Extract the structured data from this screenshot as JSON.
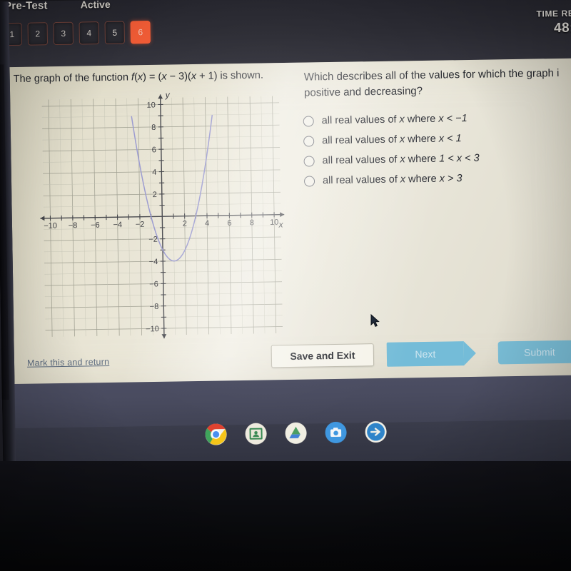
{
  "header": {
    "brand_title": "Pre-Test",
    "status": "Active",
    "question_numbers": [
      "1",
      "2",
      "3",
      "4",
      "5",
      "6"
    ],
    "active_question": "6",
    "timer_label": "TIME RE",
    "timer_value": "48:",
    "active_color": "#ef5a34"
  },
  "question": {
    "stimulus_prefix": "The graph of the function ",
    "stimulus_fn": "f",
    "stimulus_mid": "(",
    "stimulus_x1": "x",
    "stimulus_eq": ") = (",
    "stimulus_x2": "x",
    "stimulus_minus": " − 3)(",
    "stimulus_x3": "x",
    "stimulus_plus": " + 1) is shown.",
    "prompt_line1": "Which describes all of the values for which the graph i",
    "prompt_line2": "positive and decreasing?",
    "choices": [
      {
        "pre": "all real values of ",
        "var": "x",
        "mid": " where ",
        "cond": "x < −1"
      },
      {
        "pre": "all real values of ",
        "var": "x",
        "mid": " where ",
        "cond": "x < 1"
      },
      {
        "pre": "all real values of ",
        "var": "x",
        "mid": " where ",
        "cond": "1 < x < 3"
      },
      {
        "pre": "all real values of ",
        "var": "x",
        "mid": " where ",
        "cond": "x > 3"
      }
    ],
    "selected_choice": null
  },
  "chart_data": {
    "type": "line",
    "title": "",
    "xlabel": "x",
    "ylabel": "y",
    "xlim": [
      -11,
      11
    ],
    "ylim": [
      -11,
      11
    ],
    "grid": true,
    "x_tick_labels": [
      "−10",
      "−8",
      "−6",
      "−4",
      "−2",
      "2",
      "4",
      "6",
      "8",
      "10"
    ],
    "x_tick_values": [
      -10,
      -8,
      -6,
      -4,
      -2,
      2,
      4,
      6,
      8,
      10
    ],
    "y_tick_labels": [
      "10",
      "8",
      "6",
      "4",
      "2",
      "−2",
      "−4",
      "−6",
      "−8",
      "−10"
    ],
    "y_tick_values": [
      10,
      8,
      6,
      4,
      2,
      -2,
      -4,
      -6,
      -8,
      -10
    ],
    "curve_color": "#9a9ad0",
    "function": "f(x) = (x - 3)(x + 1)",
    "roots": [
      -1,
      3
    ],
    "vertex": [
      1,
      -4
    ],
    "y_intercept": -3,
    "series": [
      {
        "name": "f(x) = (x - 3)(x + 1)",
        "x": [
          -2.6,
          -2.4,
          -2.2,
          -2.0,
          -1.8,
          -1.6,
          -1.4,
          -1.2,
          -1.0,
          -0.8,
          -0.6,
          -0.4,
          -0.2,
          0.0,
          0.2,
          0.4,
          0.6,
          0.8,
          1.0,
          1.2,
          1.4,
          1.6,
          1.8,
          2.0,
          2.2,
          2.4,
          2.6,
          2.8,
          3.0,
          3.2,
          3.4,
          3.6,
          3.8,
          4.0,
          4.2,
          4.4,
          4.6
        ],
        "y": [
          12.56,
          10.56,
          8.64,
          6.8,
          5.04,
          3.36,
          1.76,
          0.24,
          0.0,
          -1.16,
          -2.24,
          -3.24,
          -3.16,
          -3.0,
          -3.56,
          -4.04,
          -3.44,
          -3.76,
          -4.0,
          -3.96,
          -3.84,
          -3.64,
          -3.36,
          -3.0,
          -2.56,
          -2.04,
          -1.44,
          -0.76,
          0.0,
          0.84,
          1.76,
          2.76,
          3.84,
          5.0,
          6.24,
          7.56,
          8.96
        ]
      }
    ]
  },
  "footer": {
    "mark_and_return": "Mark this and return",
    "save_and_exit": "Save and Exit",
    "next": "Next",
    "submit": "Submit",
    "next_color": "#74bcd8",
    "submit_color": "#79bdd6"
  },
  "shelf": {
    "icons": [
      {
        "name": "chrome-icon",
        "label": "Chrome"
      },
      {
        "name": "google-classroom-icon",
        "label": "Classroom"
      },
      {
        "name": "google-drive-icon",
        "label": "Drive"
      },
      {
        "name": "camera-icon",
        "label": "Camera"
      },
      {
        "name": "arrow-app-icon",
        "label": "Arrow app"
      }
    ]
  }
}
